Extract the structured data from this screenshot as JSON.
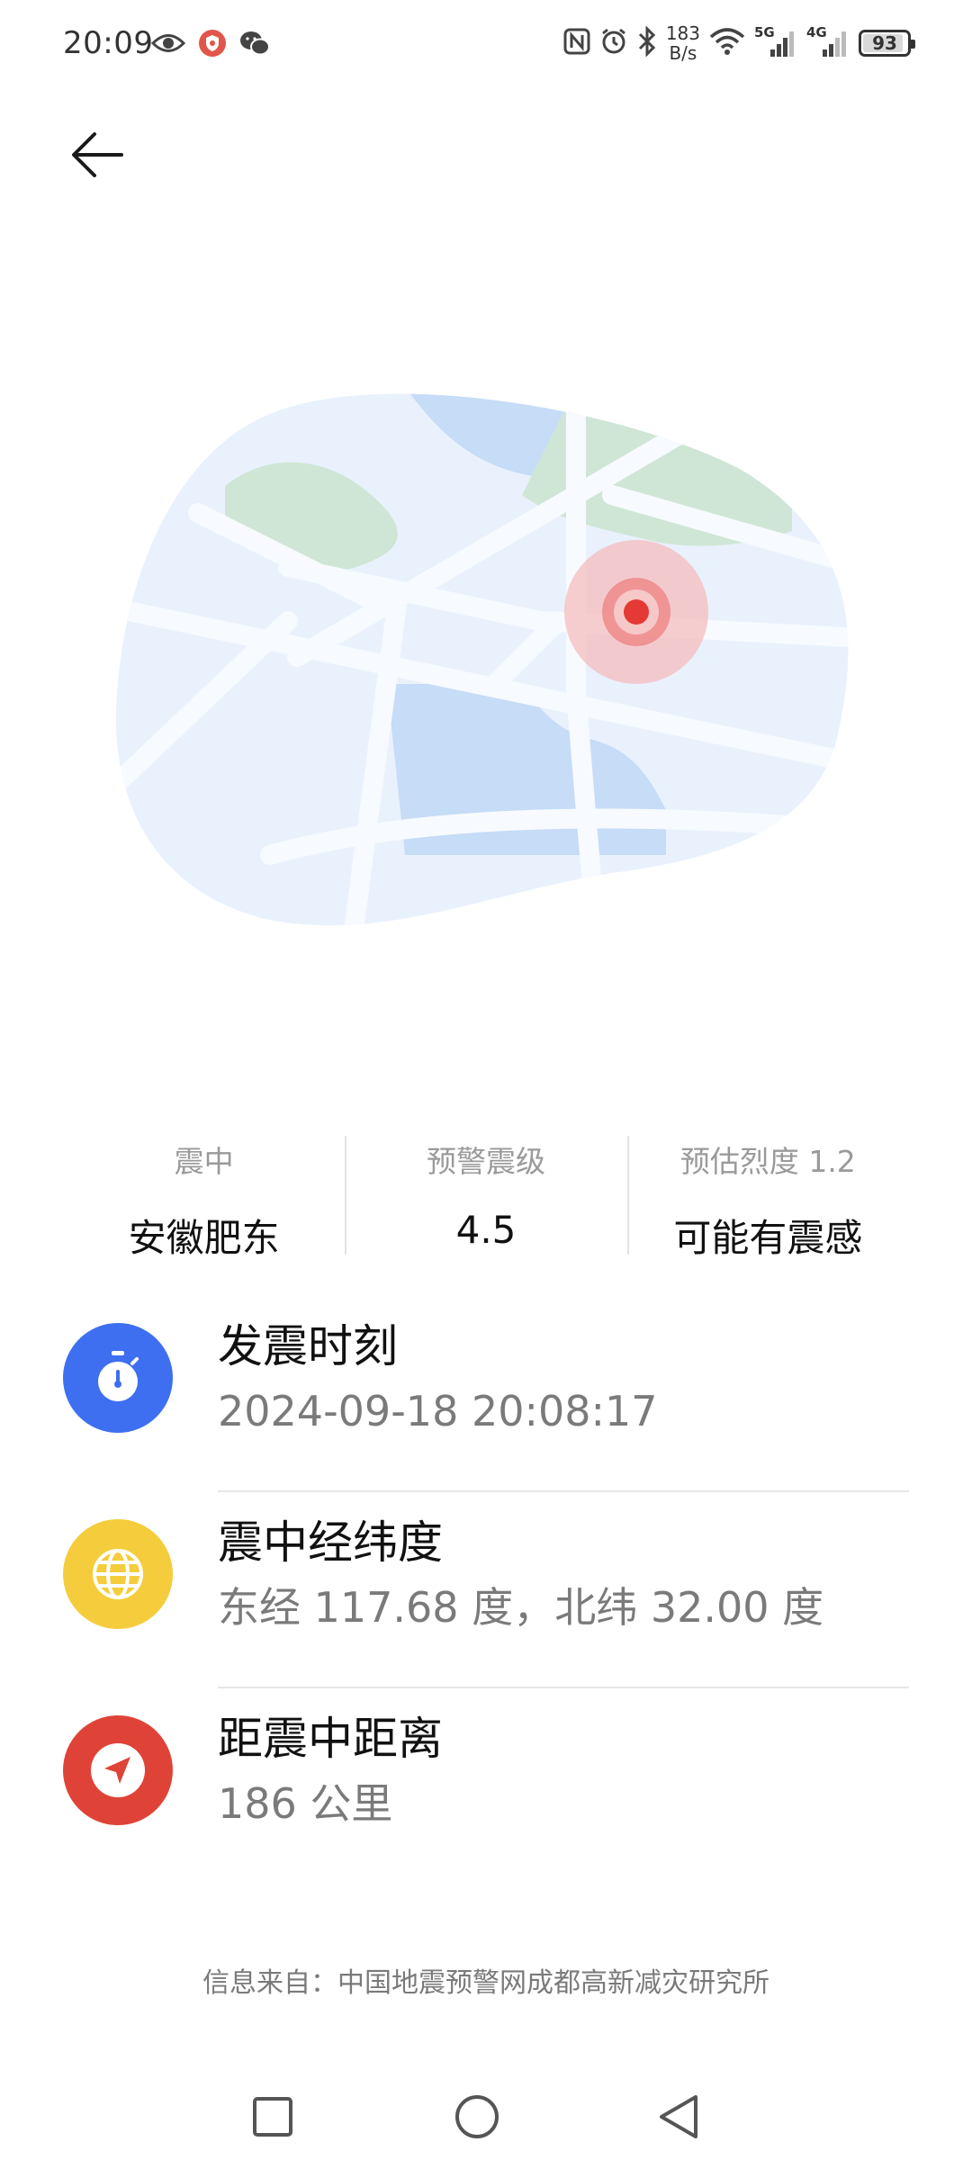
{
  "status_bar": {
    "time": "20:09",
    "net_speed_value": "183",
    "net_speed_unit": "B/s",
    "battery": "93",
    "battery_level_percent": 93,
    "left_icons": [
      "eye-icon",
      "shield-app-icon",
      "wechat-icon"
    ],
    "right_icons": [
      "nfc-icon",
      "alarm-icon",
      "bluetooth-icon",
      "wifi-icon",
      "signal-5g-icon",
      "signal-4g-icon",
      "battery-icon"
    ],
    "signal_labels": [
      "5G",
      "4G"
    ]
  },
  "header": {
    "back_icon": "arrow-left-icon"
  },
  "map": {
    "colors": {
      "land": "#e9f1fd",
      "water": "#c6dcf7",
      "park": "#cfe6d6",
      "road": "#f7faff",
      "epicenter": "#e53935"
    }
  },
  "stats": [
    {
      "label": "震中",
      "value": "安徽肥东"
    },
    {
      "label": "预警震级",
      "value": "4.5"
    },
    {
      "label": "预估烈度 1.2",
      "value": "可能有震感"
    }
  ],
  "details": [
    {
      "icon": "stopwatch-icon",
      "color": "#3d6ff0",
      "title": "发震时刻",
      "value": "2024-09-18 20:08:17"
    },
    {
      "icon": "globe-icon",
      "color": "#f5cd3c",
      "title": "震中经纬度",
      "value": "东经 117.68 度，北纬 32.00 度"
    },
    {
      "icon": "navigation-arrow-icon",
      "color": "#df4338",
      "title": "距震中距离",
      "value": "186 公里"
    }
  ],
  "source_note": "信息来自：中国地震预警网成都高新减灾研究所",
  "nav_bar": {
    "icons": [
      "recent-apps-square-icon",
      "home-circle-icon",
      "back-triangle-icon"
    ]
  }
}
